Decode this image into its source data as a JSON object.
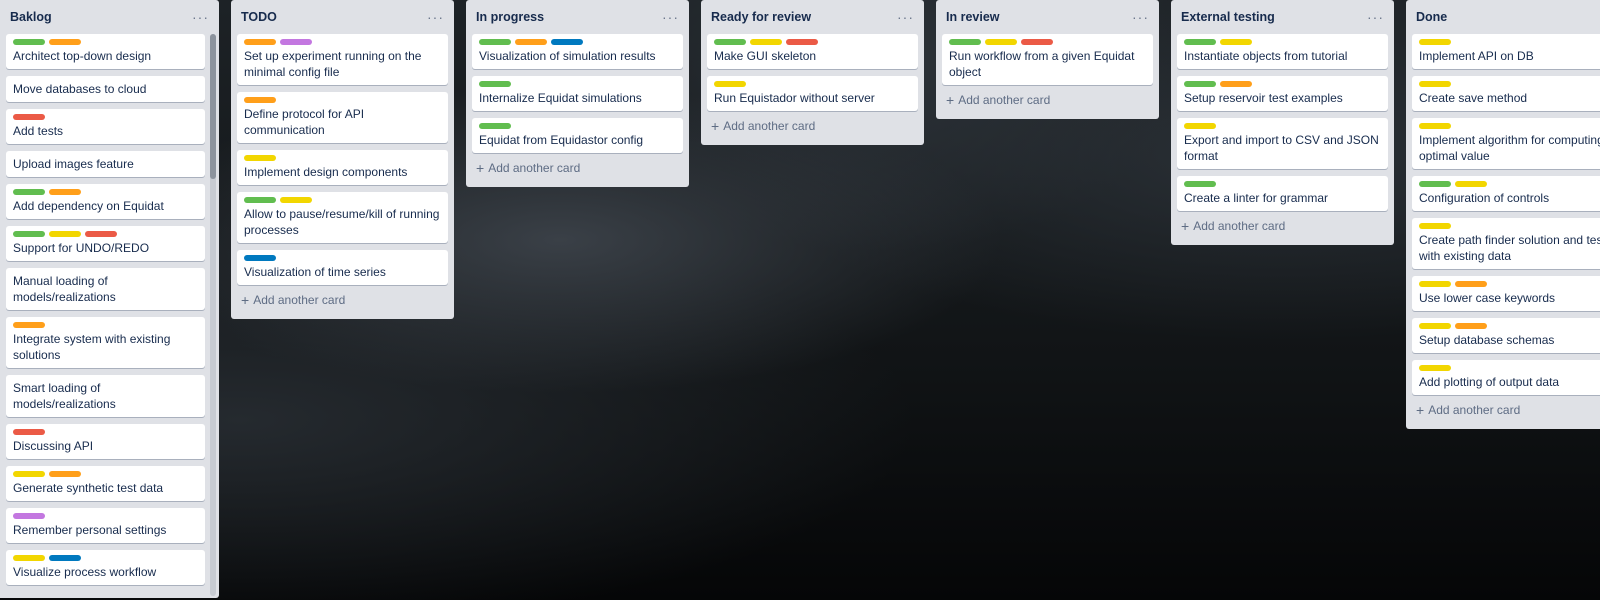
{
  "colors": {
    "green": "#61bd4f",
    "orange": "#ff9f1a",
    "red": "#eb5a46",
    "yellow": "#f2d600",
    "purple": "#c377e0",
    "blue": "#0079bf"
  },
  "add_card_label": "Add another card",
  "menu_glyph": "···",
  "lists": [
    {
      "title": "Baklog",
      "cards": [
        {
          "labels": [
            "green",
            "orange"
          ],
          "title": "Architect top-down design"
        },
        {
          "labels": [],
          "title": "Move databases to cloud"
        },
        {
          "labels": [
            "red"
          ],
          "title": "Add tests"
        },
        {
          "labels": [],
          "title": "Upload images feature"
        },
        {
          "labels": [
            "green",
            "orange"
          ],
          "title": "Add dependency on Equidat"
        },
        {
          "labels": [
            "green",
            "yellow",
            "red"
          ],
          "title": "Support for UNDO/REDO"
        },
        {
          "labels": [],
          "title": "Manual loading of models/realizations"
        },
        {
          "labels": [
            "orange"
          ],
          "title": "Integrate system with existing solutions"
        },
        {
          "labels": [],
          "title": "Smart loading of models/realizations"
        },
        {
          "labels": [
            "red"
          ],
          "title": "Discussing API"
        },
        {
          "labels": [
            "yellow",
            "orange"
          ],
          "title": "Generate synthetic test data"
        },
        {
          "labels": [
            "purple"
          ],
          "title": "Remember personal settings"
        },
        {
          "labels": [
            "yellow",
            "blue"
          ],
          "title": "Visualize process workflow"
        }
      ]
    },
    {
      "title": "TODO",
      "cards": [
        {
          "labels": [
            "orange",
            "purple"
          ],
          "title": "Set up experiment running on the minimal config file"
        },
        {
          "labels": [
            "orange"
          ],
          "title": "Define protocol for API communication"
        },
        {
          "labels": [
            "yellow"
          ],
          "title": "Implement design components"
        },
        {
          "labels": [
            "green",
            "yellow"
          ],
          "title": "Allow to pause/resume/kill of running processes"
        },
        {
          "labels": [
            "blue"
          ],
          "title": "Visualization of time series"
        }
      ]
    },
    {
      "title": "In progress",
      "cards": [
        {
          "labels": [
            "green",
            "orange",
            "blue"
          ],
          "title": "Visualization of simulation results"
        },
        {
          "labels": [
            "green"
          ],
          "title": "Internalize Equidat simulations"
        },
        {
          "labels": [
            "green"
          ],
          "title": "Equidat from Equidastor config"
        }
      ]
    },
    {
      "title": "Ready for review",
      "cards": [
        {
          "labels": [
            "green",
            "yellow",
            "red"
          ],
          "title": "Make GUI skeleton"
        },
        {
          "labels": [
            "yellow"
          ],
          "title": "Run Equistador without server"
        }
      ]
    },
    {
      "title": "In review",
      "cards": [
        {
          "labels": [
            "green",
            "yellow",
            "red"
          ],
          "title": "Run workflow from a given Equidat object"
        }
      ]
    },
    {
      "title": "External testing",
      "cards": [
        {
          "labels": [
            "green",
            "yellow"
          ],
          "title": "Instantiate objects from tutorial"
        },
        {
          "labels": [
            "green",
            "orange"
          ],
          "title": "Setup reservoir test examples"
        },
        {
          "labels": [
            "yellow"
          ],
          "title": "Export and import to CSV and JSON format"
        },
        {
          "labels": [
            "green"
          ],
          "title": "Create a linter for grammar"
        }
      ]
    },
    {
      "title": "Done",
      "cards": [
        {
          "labels": [
            "yellow"
          ],
          "title": "Implement API on DB"
        },
        {
          "labels": [
            "yellow"
          ],
          "title": "Create save method"
        },
        {
          "labels": [
            "yellow"
          ],
          "title": "Implement algorithm for computing optimal value"
        },
        {
          "labels": [
            "green",
            "yellow"
          ],
          "title": "Configuration of controls"
        },
        {
          "labels": [
            "yellow"
          ],
          "title": "Create path finder solution and test with existing data"
        },
        {
          "labels": [
            "yellow",
            "orange"
          ],
          "title": "Use lower case keywords"
        },
        {
          "labels": [
            "yellow",
            "orange"
          ],
          "title": "Setup database schemas"
        },
        {
          "labels": [
            "yellow"
          ],
          "title": "Add plotting of output data"
        }
      ]
    }
  ]
}
